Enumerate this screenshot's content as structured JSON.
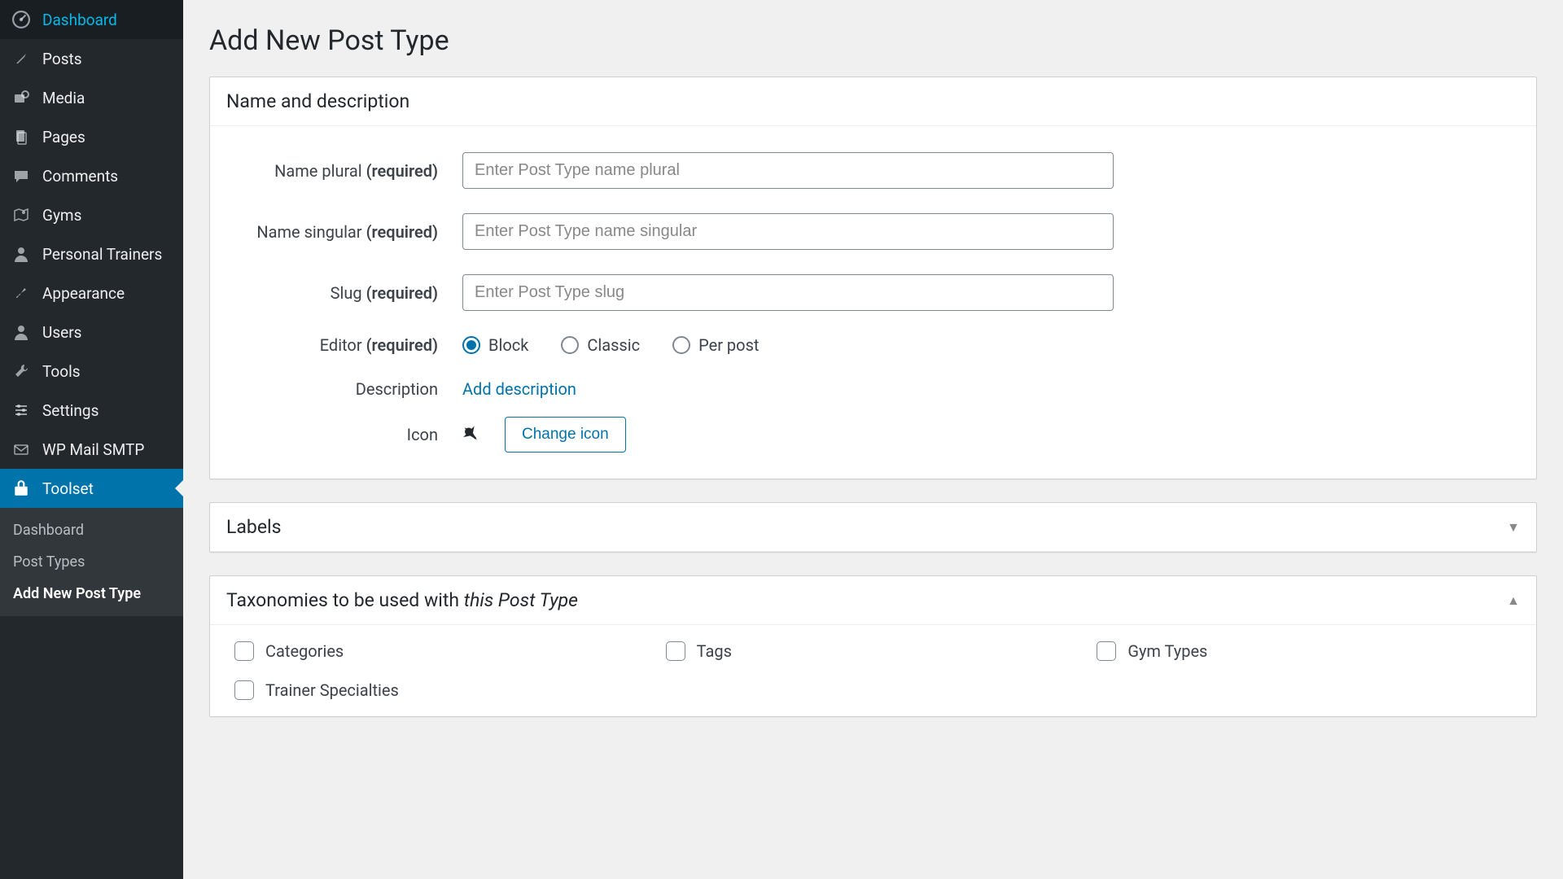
{
  "page_title": "Add New Post Type",
  "sidebar": {
    "items": [
      {
        "icon": "dashboard",
        "label": "Dashboard"
      },
      {
        "icon": "pin",
        "label": "Posts"
      },
      {
        "icon": "media",
        "label": "Media"
      },
      {
        "icon": "page",
        "label": "Pages"
      },
      {
        "icon": "comment",
        "label": "Comments"
      },
      {
        "icon": "map",
        "label": "Gyms"
      },
      {
        "icon": "person",
        "label": "Personal Trainers"
      },
      {
        "icon": "brush",
        "label": "Appearance"
      },
      {
        "icon": "person",
        "label": "Users"
      },
      {
        "icon": "wrench",
        "label": "Tools"
      },
      {
        "icon": "sliders",
        "label": "Settings"
      },
      {
        "icon": "mail",
        "label": "WP Mail SMTP"
      },
      {
        "icon": "toolset",
        "label": "Toolset",
        "active": true
      }
    ],
    "sub": [
      {
        "label": "Dashboard"
      },
      {
        "label": "Post Types"
      },
      {
        "label": "Add New Post Type",
        "current": true
      }
    ]
  },
  "panels": {
    "name_desc": {
      "title": "Name and description",
      "fields": {
        "name_plural": {
          "label": "Name plural",
          "required": "(required)",
          "placeholder": "Enter Post Type name plural",
          "value": ""
        },
        "name_singular": {
          "label": "Name singular",
          "required": "(required)",
          "placeholder": "Enter Post Type name singular",
          "value": ""
        },
        "slug": {
          "label": "Slug",
          "required": "(required)",
          "placeholder": "Enter Post Type slug",
          "value": ""
        },
        "editor": {
          "label": "Editor",
          "required": "(required)",
          "options": [
            "Block",
            "Classic",
            "Per post"
          ],
          "selected": "Block"
        },
        "description": {
          "label": "Description",
          "link_text": "Add description"
        },
        "icon": {
          "label": "Icon",
          "button": "Change icon"
        }
      }
    },
    "labels": {
      "title": "Labels",
      "collapsed": true
    },
    "taxonomies": {
      "title_prefix": "Taxonomies to be used with ",
      "title_em": "this Post Type",
      "collapsed": false,
      "items": [
        "Categories",
        "Tags",
        "Gym Types",
        "Trainer Specialties"
      ]
    }
  }
}
